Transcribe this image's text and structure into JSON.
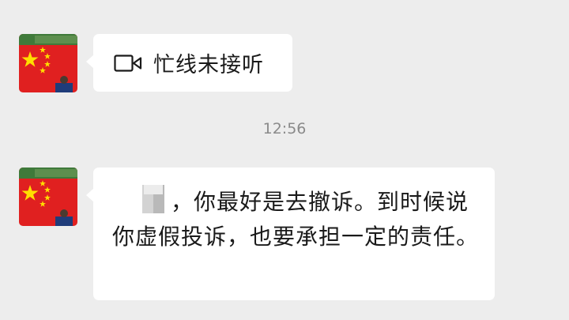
{
  "messages": [
    {
      "type": "call",
      "icon": "video-camera-icon",
      "text": "忙线未接听"
    },
    {
      "type": "text",
      "text": "，你最好是去撤诉。到时候说你虚假投诉，也要承担一定的责任。"
    }
  ],
  "timestamp": "12:56",
  "colors": {
    "background": "#ededed",
    "bubble": "#ffffff",
    "text": "#1a1a1a",
    "timestamp": "#8a8a8a",
    "flag_red": "#e02020",
    "flag_star": "#ffde00"
  }
}
